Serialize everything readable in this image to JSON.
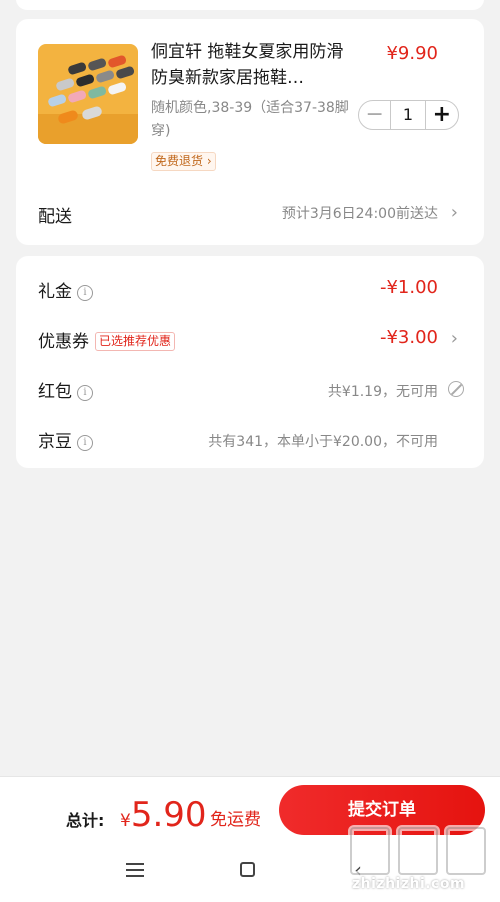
{
  "product": {
    "title": "侗宜轩 拖鞋女夏家用防滑防臭新款家居拖鞋…",
    "price": "¥9.90",
    "spec": "随机颜色,38-39（适合37-38脚穿)",
    "quantity": "1",
    "minus": "−",
    "plus": "+",
    "free_return": "免费退货",
    "delivery_label": "配送",
    "delivery_value": "预计3月6日24:00前送达"
  },
  "discounts": {
    "gift_label": "礼金",
    "gift_value": "-¥1.00",
    "coupon_label": "优惠券",
    "coupon_tag": "已选推荐优惠",
    "coupon_value": "-¥3.00",
    "redpacket_label": "红包",
    "redpacket_value": "共¥1.19，无可用",
    "jingdou_label": "京豆",
    "jingdou_value": "共有341，本单小于¥20.00，不可用"
  },
  "footer": {
    "total_label": "总计:",
    "currency": "¥",
    "total_value": "5.90",
    "free_shipping": "免运费",
    "submit_label": "提交订单"
  },
  "watermark": {
    "text": "zhizhizhi.com",
    "logo": "值值值"
  },
  "colors": {
    "accent": "#e1251b",
    "page_bg": "#f2f2f2"
  }
}
